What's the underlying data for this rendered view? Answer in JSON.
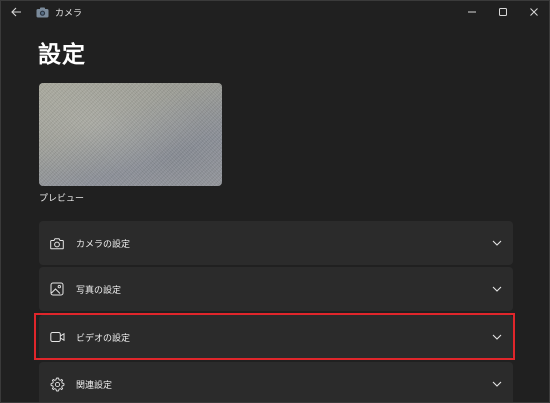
{
  "window": {
    "title": "カメラ"
  },
  "page": {
    "title": "設定"
  },
  "preview": {
    "label": "プレビュー"
  },
  "settings": {
    "items": [
      {
        "label": "カメラの設定",
        "icon": "camera-icon"
      },
      {
        "label": "写真の設定",
        "icon": "photo-icon"
      },
      {
        "label": "ビデオの設定",
        "icon": "video-icon"
      },
      {
        "label": "関連設定",
        "icon": "gear-icon"
      }
    ]
  },
  "colors": {
    "background": "#202020",
    "card": "#2b2b2b",
    "highlight": "#e0262b"
  }
}
